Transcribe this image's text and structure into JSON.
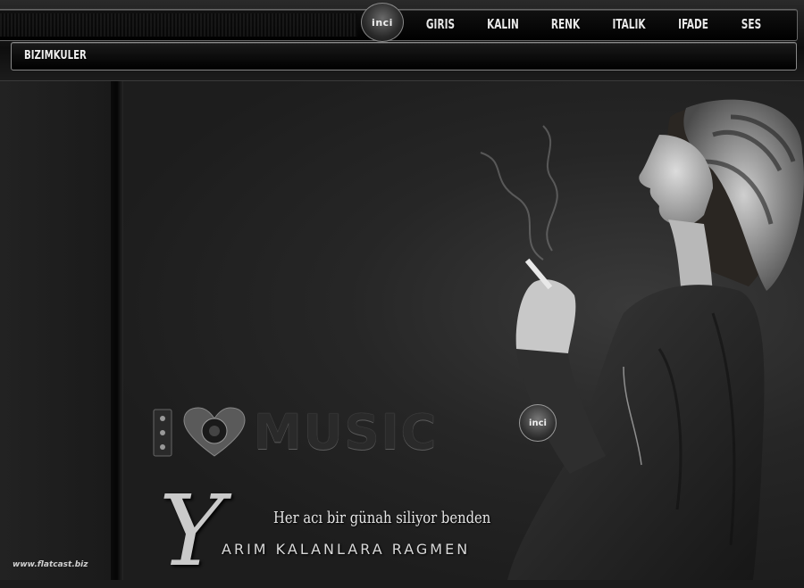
{
  "header": {
    "logo_text": "inci",
    "nav": [
      "GIRIS",
      "KALIN",
      "RENK",
      "ITALIK",
      "IFADE",
      "SES"
    ]
  },
  "subbar": {
    "title": "BIZIMKULER"
  },
  "artwork": {
    "logo_text": "inci",
    "music_heading": "MUSIC",
    "big_letter": "Y",
    "tagline": "Her acı bir günah siliyor benden",
    "subtitle": "ARIM KALANLARA RAGMEN",
    "watermark": "www.flatcast.biz"
  }
}
